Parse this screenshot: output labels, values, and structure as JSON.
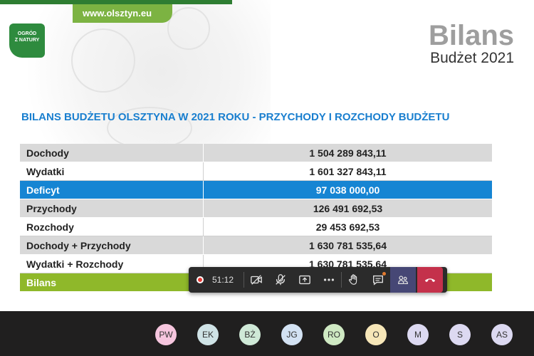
{
  "slide": {
    "url": "www.olsztyn.eu",
    "logo_text": "OGRÓD Z NATURY",
    "title": "Bilans",
    "subtitle": "Budżet 2021",
    "heading": "BILANS BUDŻETU OLSZTYNA W 2021 ROKU - PRZYCHODY I ROZCHODY BUDŻETU",
    "rows": [
      {
        "label": "Dochody",
        "value": "1 504 289 843,11"
      },
      {
        "label": "Wydatki",
        "value": "1 601 327 843,11"
      },
      {
        "label": "Deficyt",
        "value": "97 038 000,00"
      },
      {
        "label": "Przychody",
        "value": "126 491 692,53"
      },
      {
        "label": "Rozchody",
        "value": "29 453 692,53"
      },
      {
        "label": "Dochody + Przychody",
        "value": "1 630 781 535,64"
      },
      {
        "label": "Wydatki + Rozchody",
        "value": "1 630 781 535,64"
      },
      {
        "label": "Bilans",
        "value": ""
      }
    ]
  },
  "meeting": {
    "timer": "51:12",
    "controls": [
      "record-icon",
      "camera-off-icon",
      "mic-off-icon",
      "share-icon",
      "more-icon",
      "raise-hand-icon",
      "chat-icon",
      "people-icon",
      "hang-up-icon"
    ],
    "hangup_color": "#c4314b",
    "record_color": "#e53935"
  },
  "participants": [
    {
      "initials": "PW",
      "color": "#f6c6de"
    },
    {
      "initials": "EK",
      "color": "#cfe3e6"
    },
    {
      "initials": "BŻ",
      "color": "#cfe9d7"
    },
    {
      "initials": "JG",
      "color": "#d3e2f3"
    },
    {
      "initials": "RO",
      "color": "#cfe9c3"
    },
    {
      "initials": "O",
      "color": "#f6e6b8"
    },
    {
      "initials": "M",
      "color": "#dcd9f1"
    },
    {
      "initials": "S",
      "color": "#dcd9f1"
    },
    {
      "initials": "AS",
      "color": "#dcd9f1"
    }
  ]
}
